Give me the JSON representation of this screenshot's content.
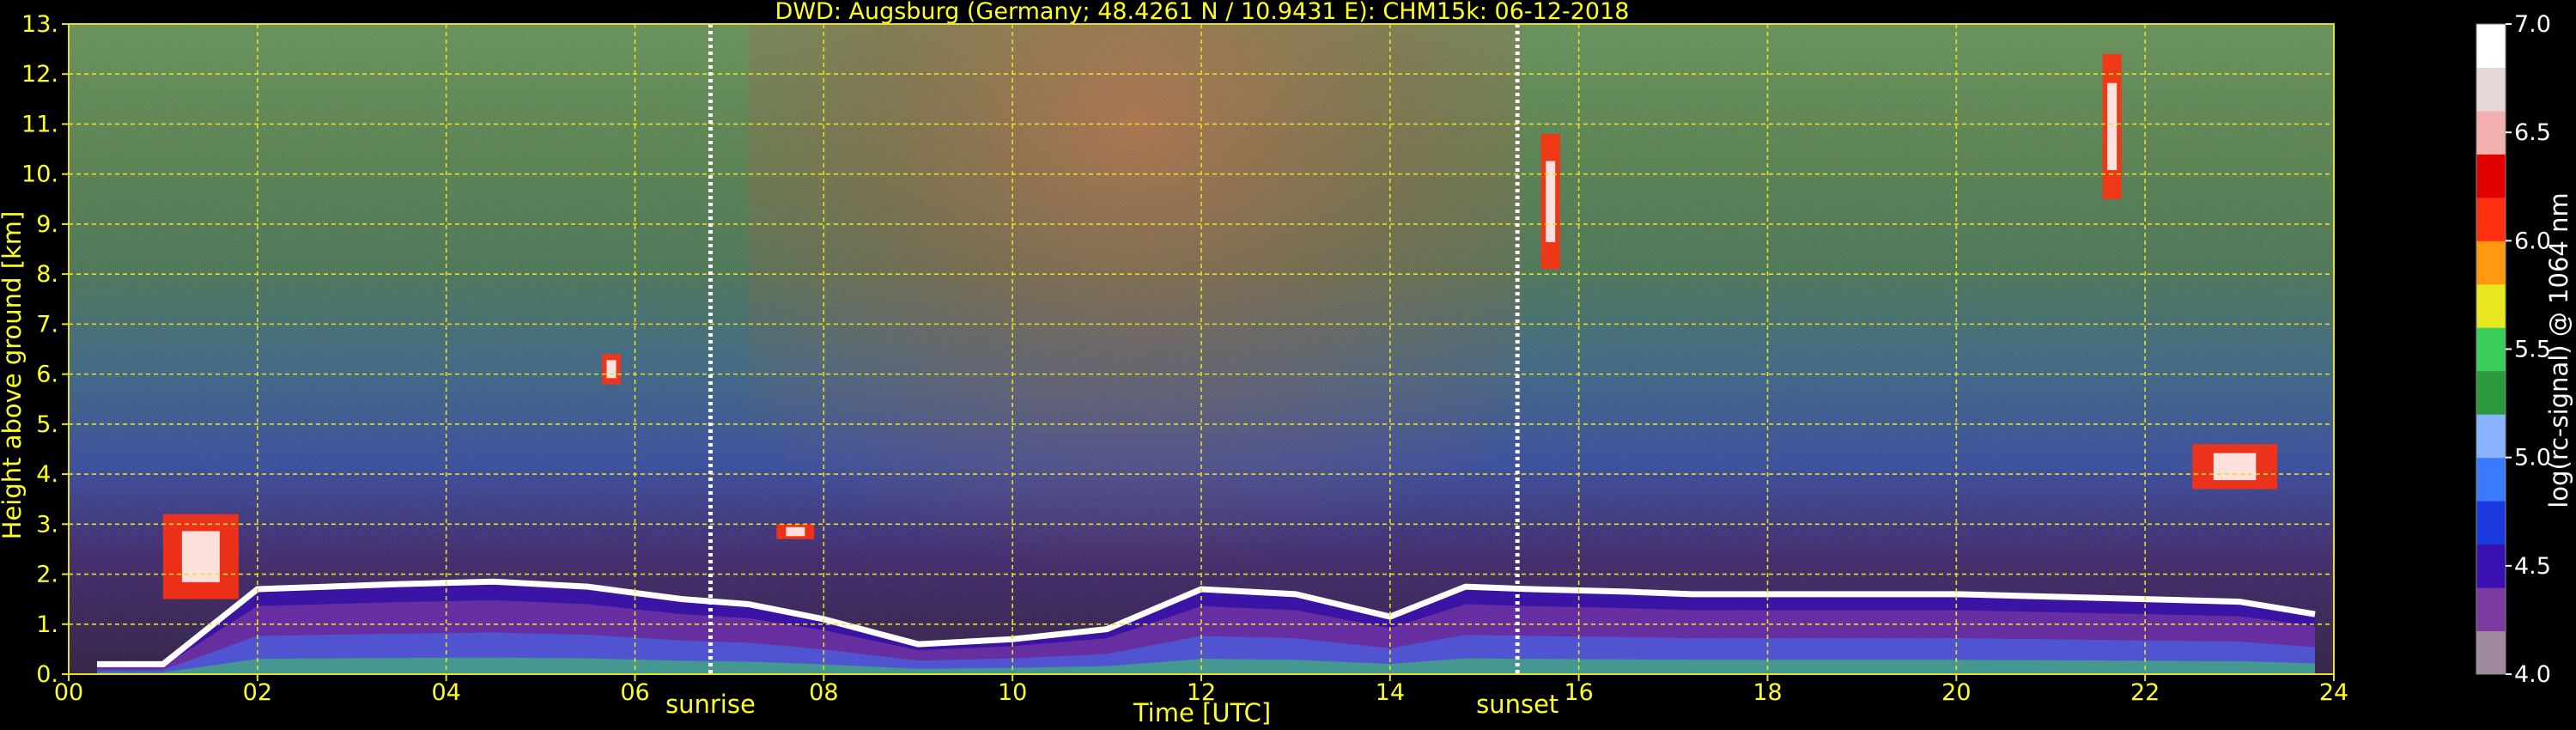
{
  "chart_data": {
    "type": "heatmap",
    "title": "DWD: Augsburg (Germany; 48.4261 N / 10.9431 E):    CHM15k: 06-12-2018",
    "xlabel": "Time [UTC]",
    "ylabel": "Height above ground [km]",
    "colorbar_label": "log(rc-signal) @ 1064 nm",
    "x_range": [
      0,
      24
    ],
    "y_range": [
      0,
      13
    ],
    "x_ticks": [
      "00",
      "02",
      "04",
      "06",
      "08",
      "10",
      "12",
      "14",
      "16",
      "18",
      "20",
      "22",
      "24"
    ],
    "y_ticks": [
      "0.",
      "1.",
      "2.",
      "3.",
      "4.",
      "5.",
      "6.",
      "7.",
      "8.",
      "9.",
      "10.",
      "11.",
      "12.",
      "13."
    ],
    "colorbar_range": [
      4.0,
      7.0
    ],
    "colorbar_ticks": [
      "4.0",
      "4.5",
      "5.0",
      "5.5",
      "6.0",
      "6.5",
      "7.0"
    ],
    "grid": true,
    "markers": [
      {
        "label": "sunrise",
        "x": 6.8
      },
      {
        "label": "sunset",
        "x": 15.35
      }
    ],
    "colormap": [
      "#a08aa0",
      "#7a3aa0",
      "#3a10b0",
      "#1a3ae0",
      "#3a7aff",
      "#8ab4ff",
      "#2a9a3a",
      "#3acf5a",
      "#e8e820",
      "#ff9a10",
      "#ff3010",
      "#e00000",
      "#f4b0b0",
      "#e8d8d8",
      "#ffffff"
    ],
    "features": [
      {
        "name": "boundary layer top",
        "x": [
          0.3,
          1.0,
          2.0,
          3.5,
          4.5,
          5.5,
          6.5,
          7.2,
          8.0,
          9.0,
          10.0,
          11.0,
          12.0,
          13.0,
          14.0,
          14.8,
          15.5,
          16.5,
          17.2,
          17.8,
          19.0,
          20.0,
          21.0,
          22.0,
          23.0,
          23.8
        ],
        "y": [
          0.2,
          0.2,
          1.7,
          1.8,
          1.85,
          1.75,
          1.5,
          1.4,
          1.1,
          0.6,
          0.7,
          0.9,
          1.7,
          1.6,
          1.15,
          1.75,
          1.7,
          1.65,
          1.6,
          1.6,
          1.6,
          1.6,
          1.55,
          1.5,
          1.45,
          1.2
        ]
      },
      {
        "name": "cloud",
        "x": [
          5.65,
          5.85
        ],
        "y": [
          5.8,
          6.4
        ]
      },
      {
        "name": "cloud",
        "x": [
          15.6,
          15.8
        ],
        "y": [
          8.1,
          10.8
        ]
      },
      {
        "name": "cloud",
        "x": [
          21.55,
          21.75
        ],
        "y": [
          9.5,
          12.4
        ]
      },
      {
        "name": "cloud",
        "x": [
          22.5,
          23.4
        ],
        "y": [
          3.7,
          4.6
        ]
      },
      {
        "name": "cloud",
        "x": [
          1.0,
          1.8
        ],
        "y": [
          1.5,
          3.2
        ]
      },
      {
        "name": "cloud",
        "x": [
          7.5,
          7.9
        ],
        "y": [
          2.7,
          3.0
        ]
      }
    ]
  }
}
